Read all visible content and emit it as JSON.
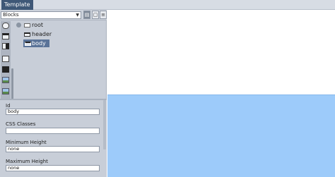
{
  "menubar": {
    "template_label": "Template"
  },
  "selector": {
    "value": "Blocks"
  },
  "tree": {
    "nodes": [
      {
        "label": "root"
      },
      {
        "label": "header"
      },
      {
        "label": "body"
      }
    ]
  },
  "properties": {
    "fields": [
      {
        "label": "Id",
        "value": "body"
      },
      {
        "label": "CSS Classes",
        "value": ""
      },
      {
        "label": "Minimum Height",
        "value": "none"
      },
      {
        "label": "Maximum Height",
        "value": "none"
      }
    ]
  },
  "colors": {
    "menu_button": "#3f5877",
    "panel": "#c8ced8",
    "selected_node": "#5a7398",
    "body_block": "#9dcbfa"
  },
  "icons": [
    "chevron-down-icon",
    "document-icon",
    "page-icon",
    "settings-icon",
    "menu-icon",
    "block-icon",
    "image-icon"
  ]
}
